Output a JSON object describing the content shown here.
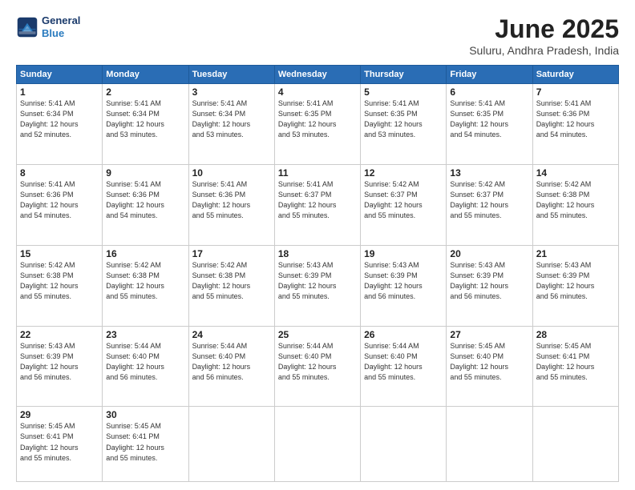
{
  "logo": {
    "line1": "General",
    "line2": "Blue"
  },
  "title": "June 2025",
  "subtitle": "Suluru, Andhra Pradesh, India",
  "weekdays": [
    "Sunday",
    "Monday",
    "Tuesday",
    "Wednesday",
    "Thursday",
    "Friday",
    "Saturday"
  ],
  "weeks": [
    [
      {
        "day": "1",
        "info": "Sunrise: 5:41 AM\nSunset: 6:34 PM\nDaylight: 12 hours\nand 52 minutes."
      },
      {
        "day": "2",
        "info": "Sunrise: 5:41 AM\nSunset: 6:34 PM\nDaylight: 12 hours\nand 53 minutes."
      },
      {
        "day": "3",
        "info": "Sunrise: 5:41 AM\nSunset: 6:34 PM\nDaylight: 12 hours\nand 53 minutes."
      },
      {
        "day": "4",
        "info": "Sunrise: 5:41 AM\nSunset: 6:35 PM\nDaylight: 12 hours\nand 53 minutes."
      },
      {
        "day": "5",
        "info": "Sunrise: 5:41 AM\nSunset: 6:35 PM\nDaylight: 12 hours\nand 53 minutes."
      },
      {
        "day": "6",
        "info": "Sunrise: 5:41 AM\nSunset: 6:35 PM\nDaylight: 12 hours\nand 54 minutes."
      },
      {
        "day": "7",
        "info": "Sunrise: 5:41 AM\nSunset: 6:36 PM\nDaylight: 12 hours\nand 54 minutes."
      }
    ],
    [
      {
        "day": "8",
        "info": "Sunrise: 5:41 AM\nSunset: 6:36 PM\nDaylight: 12 hours\nand 54 minutes."
      },
      {
        "day": "9",
        "info": "Sunrise: 5:41 AM\nSunset: 6:36 PM\nDaylight: 12 hours\nand 54 minutes."
      },
      {
        "day": "10",
        "info": "Sunrise: 5:41 AM\nSunset: 6:36 PM\nDaylight: 12 hours\nand 55 minutes."
      },
      {
        "day": "11",
        "info": "Sunrise: 5:41 AM\nSunset: 6:37 PM\nDaylight: 12 hours\nand 55 minutes."
      },
      {
        "day": "12",
        "info": "Sunrise: 5:42 AM\nSunset: 6:37 PM\nDaylight: 12 hours\nand 55 minutes."
      },
      {
        "day": "13",
        "info": "Sunrise: 5:42 AM\nSunset: 6:37 PM\nDaylight: 12 hours\nand 55 minutes."
      },
      {
        "day": "14",
        "info": "Sunrise: 5:42 AM\nSunset: 6:38 PM\nDaylight: 12 hours\nand 55 minutes."
      }
    ],
    [
      {
        "day": "15",
        "info": "Sunrise: 5:42 AM\nSunset: 6:38 PM\nDaylight: 12 hours\nand 55 minutes."
      },
      {
        "day": "16",
        "info": "Sunrise: 5:42 AM\nSunset: 6:38 PM\nDaylight: 12 hours\nand 55 minutes."
      },
      {
        "day": "17",
        "info": "Sunrise: 5:42 AM\nSunset: 6:38 PM\nDaylight: 12 hours\nand 55 minutes."
      },
      {
        "day": "18",
        "info": "Sunrise: 5:43 AM\nSunset: 6:39 PM\nDaylight: 12 hours\nand 55 minutes."
      },
      {
        "day": "19",
        "info": "Sunrise: 5:43 AM\nSunset: 6:39 PM\nDaylight: 12 hours\nand 56 minutes."
      },
      {
        "day": "20",
        "info": "Sunrise: 5:43 AM\nSunset: 6:39 PM\nDaylight: 12 hours\nand 56 minutes."
      },
      {
        "day": "21",
        "info": "Sunrise: 5:43 AM\nSunset: 6:39 PM\nDaylight: 12 hours\nand 56 minutes."
      }
    ],
    [
      {
        "day": "22",
        "info": "Sunrise: 5:43 AM\nSunset: 6:39 PM\nDaylight: 12 hours\nand 56 minutes."
      },
      {
        "day": "23",
        "info": "Sunrise: 5:44 AM\nSunset: 6:40 PM\nDaylight: 12 hours\nand 56 minutes."
      },
      {
        "day": "24",
        "info": "Sunrise: 5:44 AM\nSunset: 6:40 PM\nDaylight: 12 hours\nand 56 minutes."
      },
      {
        "day": "25",
        "info": "Sunrise: 5:44 AM\nSunset: 6:40 PM\nDaylight: 12 hours\nand 55 minutes."
      },
      {
        "day": "26",
        "info": "Sunrise: 5:44 AM\nSunset: 6:40 PM\nDaylight: 12 hours\nand 55 minutes."
      },
      {
        "day": "27",
        "info": "Sunrise: 5:45 AM\nSunset: 6:40 PM\nDaylight: 12 hours\nand 55 minutes."
      },
      {
        "day": "28",
        "info": "Sunrise: 5:45 AM\nSunset: 6:41 PM\nDaylight: 12 hours\nand 55 minutes."
      }
    ],
    [
      {
        "day": "29",
        "info": "Sunrise: 5:45 AM\nSunset: 6:41 PM\nDaylight: 12 hours\nand 55 minutes."
      },
      {
        "day": "30",
        "info": "Sunrise: 5:45 AM\nSunset: 6:41 PM\nDaylight: 12 hours\nand 55 minutes."
      },
      null,
      null,
      null,
      null,
      null
    ]
  ]
}
